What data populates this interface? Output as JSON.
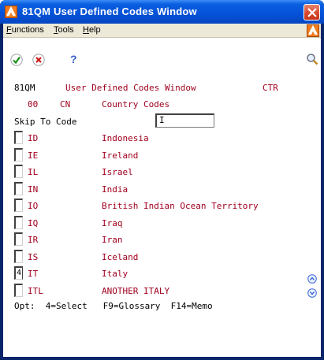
{
  "window": {
    "title": "81QM  User Defined Codes Window"
  },
  "menu": {
    "functions": "unctions",
    "functions_key": "F",
    "tools": "ools",
    "tools_key": "T",
    "help": "elp",
    "help_key": "H"
  },
  "toolbar": {
    "help_glyph": "?"
  },
  "screen": {
    "program": "81QM",
    "heading": "User Defined Codes Window",
    "system_tag": "CTR",
    "product_code": "00",
    "code_type": "CN",
    "code_type_desc": "Country Codes",
    "skip_label": "Skip To Code",
    "skip_value": "I",
    "footer": "Opt:  4=Select   F9=Glossary  F14=Memo"
  },
  "rows": [
    {
      "opt": "",
      "code": "ID",
      "desc": "Indonesia"
    },
    {
      "opt": "",
      "code": "IE",
      "desc": "Ireland"
    },
    {
      "opt": "",
      "code": "IL",
      "desc": "Israel"
    },
    {
      "opt": "",
      "code": "IN",
      "desc": "India"
    },
    {
      "opt": "",
      "code": "IO",
      "desc": "British Indian Ocean Territory"
    },
    {
      "opt": "",
      "code": "IQ",
      "desc": "Iraq"
    },
    {
      "opt": "",
      "code": "IR",
      "desc": "Iran"
    },
    {
      "opt": "",
      "code": "IS",
      "desc": "Iceland"
    },
    {
      "opt": "4",
      "code": "IT",
      "desc": "Italy"
    },
    {
      "opt": "",
      "code": "ITL",
      "desc": "ANOTHER ITALY"
    }
  ],
  "colors": {
    "title_bar": "#0551d8",
    "text_red": "#a0001e",
    "menu_bg": "#ece9d8"
  }
}
